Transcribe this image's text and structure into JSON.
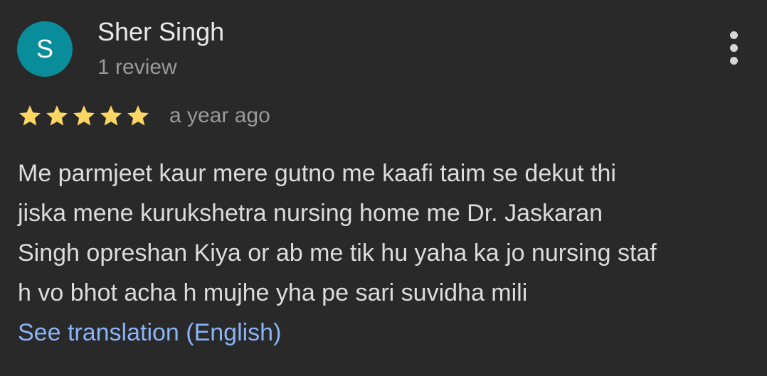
{
  "reviewer": {
    "avatar_letter": "S",
    "avatar_color": "#0a8d9a",
    "name": "Sher Singh",
    "review_count": "1 review"
  },
  "menu": {
    "icon": "more-vert-icon"
  },
  "rating": {
    "stars": 5,
    "max_stars": 5,
    "star_color": "#fdd663",
    "icon": "star-icon",
    "time": "a year ago"
  },
  "review": {
    "text": "Me parmjeet kaur mere gutno me kaafi taim se dekut thi\njiska mene kurukshetra nursing home me Dr. Jaskaran\nSingh opreshan Kiya or ab me tik hu yaha ka jo nursing staf\nh vo bhot acha h mujhe yha pe sari suvidha mili",
    "translate_label": "See translation (English)",
    "link_color": "#8ab4f8"
  }
}
